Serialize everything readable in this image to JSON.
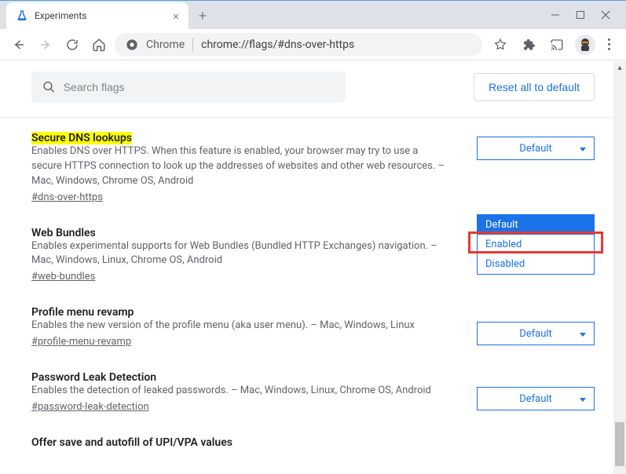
{
  "tab": {
    "title": "Experiments"
  },
  "omnibox": {
    "label": "Chrome",
    "url": "chrome://flags/#dns-over-https"
  },
  "search": {
    "placeholder": "Search flags"
  },
  "reset_btn": "Reset all to default",
  "dropdown": {
    "items": [
      "Default",
      "Enabled",
      "Disabled"
    ],
    "selected": "Default"
  },
  "flags": [
    {
      "title": "Secure DNS lookups",
      "desc": "Enables DNS over HTTPS. When this feature is enabled, your browser may try to use a secure HTTPS connection to look up the addresses of websites and other web resources. – Mac, Windows, Chrome OS, Android",
      "hash": "#dns-over-https",
      "select": "Default",
      "highlighted": true
    },
    {
      "title": "Web Bundles",
      "desc": "Enables experimental supports for Web Bundles (Bundled HTTP Exchanges) navigation. – Mac, Windows, Linux, Chrome OS, Android",
      "hash": "#web-bundles",
      "select": "Default"
    },
    {
      "title": "Profile menu revamp",
      "desc": "Enables the new version of the profile menu (aka user menu). – Mac, Windows, Linux",
      "hash": "#profile-menu-revamp",
      "select": "Default"
    },
    {
      "title": "Password Leak Detection",
      "desc": "Enables the detection of leaked passwords. – Mac, Windows, Linux, Chrome OS, Android",
      "hash": "#password-leak-detection",
      "select": "Default"
    },
    {
      "title": "Offer save and autofill of UPI/VPA values",
      "desc": "",
      "hash": "",
      "select": ""
    }
  ]
}
